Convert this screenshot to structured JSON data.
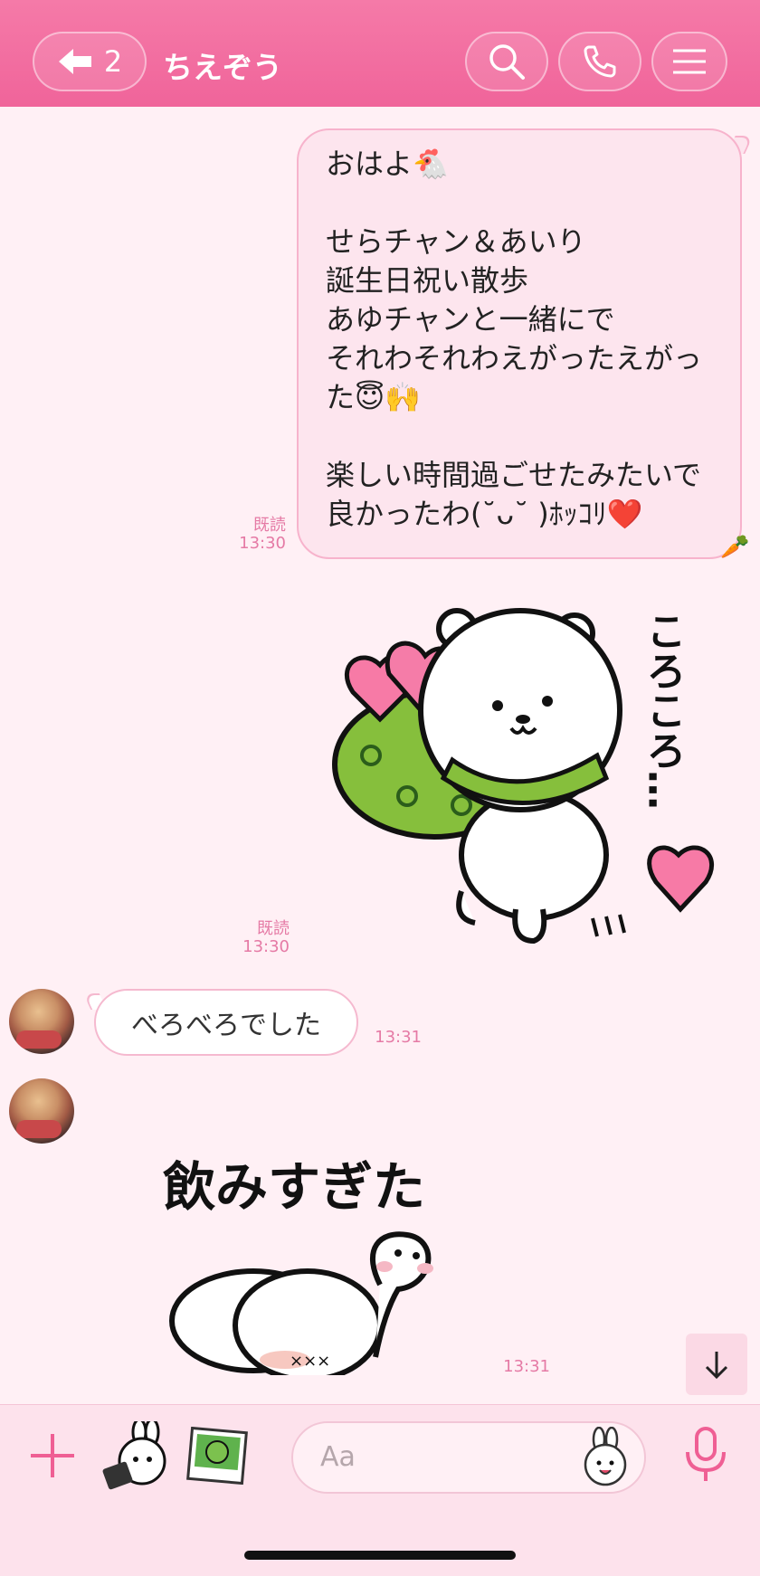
{
  "header": {
    "back_count": "2",
    "title": "ちえぞう"
  },
  "messages": {
    "outgoing_text": {
      "lines": [
        "おはよ🐔",
        "",
        "せらチャン＆あいり",
        "誕生日祝い散歩",
        "あゆチャンと一緒にで",
        "それわそれわえがったえがっ",
        "た😇🙌",
        "",
        "楽しい時間過ごせたみたいで",
        "良かったわ(˘ᴗ˘ )ﾎｯｺﾘ❤️"
      ],
      "read": "既読",
      "time": "13:30"
    },
    "outgoing_sticker": {
      "sticker_text": "ころころ…",
      "read": "既読",
      "time": "13:30"
    },
    "incoming_text": {
      "text": "べろべろでした",
      "time": "13:31"
    },
    "incoming_sticker": {
      "sticker_text": "飲みすぎた",
      "time": "13:31"
    }
  },
  "input": {
    "placeholder": "Aa"
  },
  "colors": {
    "header": "#f26a9e",
    "accent": "#ef5f94",
    "bubble_out": "#fde5ee",
    "background": "#fff0f5"
  }
}
